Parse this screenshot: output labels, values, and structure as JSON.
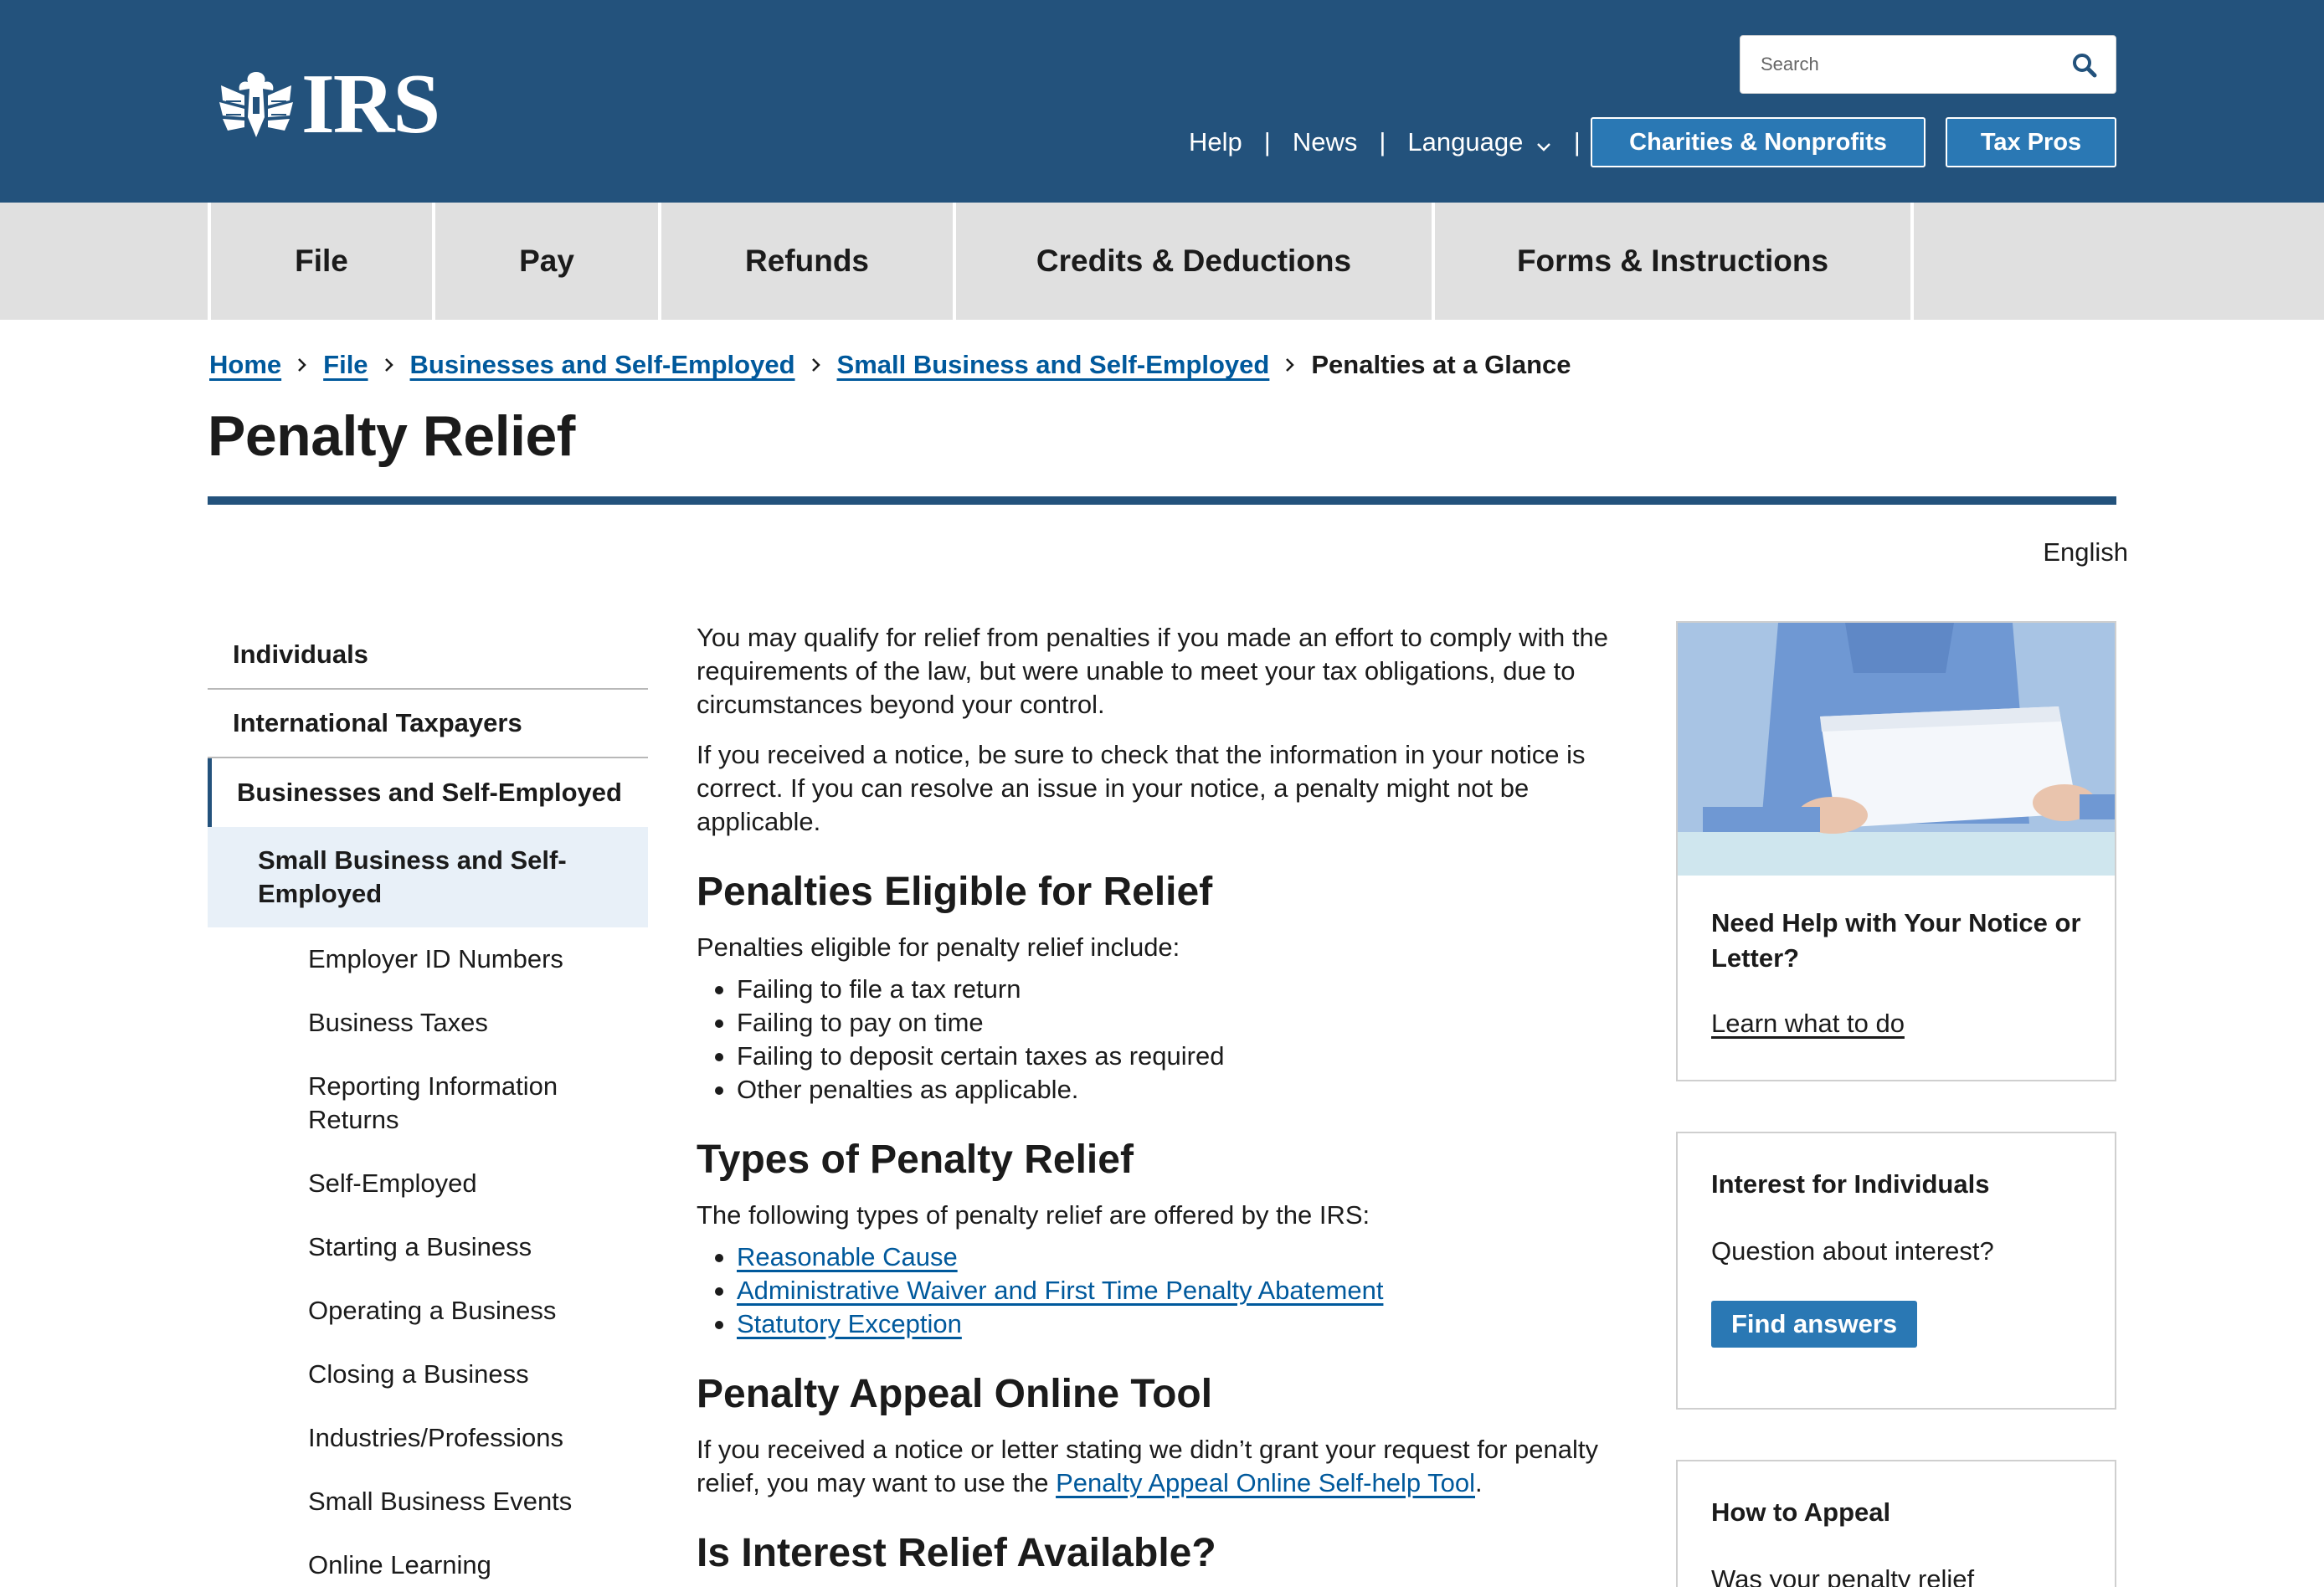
{
  "header": {
    "logo_text": "IRS",
    "search": {
      "placeholder": "Search"
    },
    "util_links": {
      "help": "Help",
      "news": "News",
      "language": "Language"
    },
    "buttons": {
      "charities": "Charities & Nonprofits",
      "tax_pros": "Tax Pros"
    },
    "colors": {
      "header_bg": "#23527c",
      "button_bg": "#2a78b4"
    }
  },
  "nav": {
    "items": [
      "File",
      "Pay",
      "Refunds",
      "Credits & Deductions",
      "Forms & Instructions"
    ]
  },
  "breadcrumb": {
    "home": "Home",
    "file": "File",
    "businesses": "Businesses and Self-Employed",
    "small_business": "Small Business and Self-Employed",
    "current": "Penalties at a Glance"
  },
  "page": {
    "title": "Penalty Relief",
    "language": "English"
  },
  "sidebar": {
    "individuals": "Individuals",
    "international": "International Taxpayers",
    "businesses": "Businesses and Self-Employed",
    "small_business": "Small Business and Self-Employed",
    "subitems": [
      "Employer ID Numbers",
      "Business Taxes",
      "Reporting Information Returns",
      "Self-Employed",
      "Starting a Business",
      "Operating a Business",
      "Closing a Business",
      "Industries/Professions",
      "Small Business Events",
      "Online Learning"
    ]
  },
  "content": {
    "intro_1": "You may qualify for relief from penalties if you made an effort to comply with the requirements of the law, but were unable to meet your tax obligations, due to circumstances beyond your control.",
    "intro_2": "If you received a notice, be sure to check that the information in your notice is correct. If you can resolve an issue in your notice, a penalty might not be applicable.",
    "h_eligible": "Penalties Eligible for Relief",
    "eligible_intro": "Penalties eligible for penalty relief include:",
    "eligible_items": [
      "Failing to file a tax return",
      "Failing to pay on time",
      "Failing to deposit certain taxes as required",
      "Other penalties as applicable."
    ],
    "h_types": "Types of Penalty Relief",
    "types_intro": "The following types of penalty relief are offered by the IRS:",
    "types_items": [
      "Reasonable Cause",
      "Administrative Waiver and First Time Penalty Abatement",
      "Statutory Exception"
    ],
    "h_appeal": "Penalty Appeal Online Tool",
    "appeal_text_before": "If you received a notice or letter stating we didn’t grant your request for penalty relief, you may want to use the ",
    "appeal_link": "Penalty Appeal Online Self-help Tool",
    "appeal_text_after": ".",
    "h_interest": "Is Interest Relief Available?"
  },
  "rail": {
    "card1": {
      "title": "Need Help with Your Notice or Letter?",
      "link": "Learn what to do"
    },
    "card2": {
      "title": "Interest for Individuals",
      "text": "Question about interest?",
      "button": "Find answers"
    },
    "card3": {
      "title": "How to Appeal",
      "text": "Was your penalty relief"
    }
  }
}
